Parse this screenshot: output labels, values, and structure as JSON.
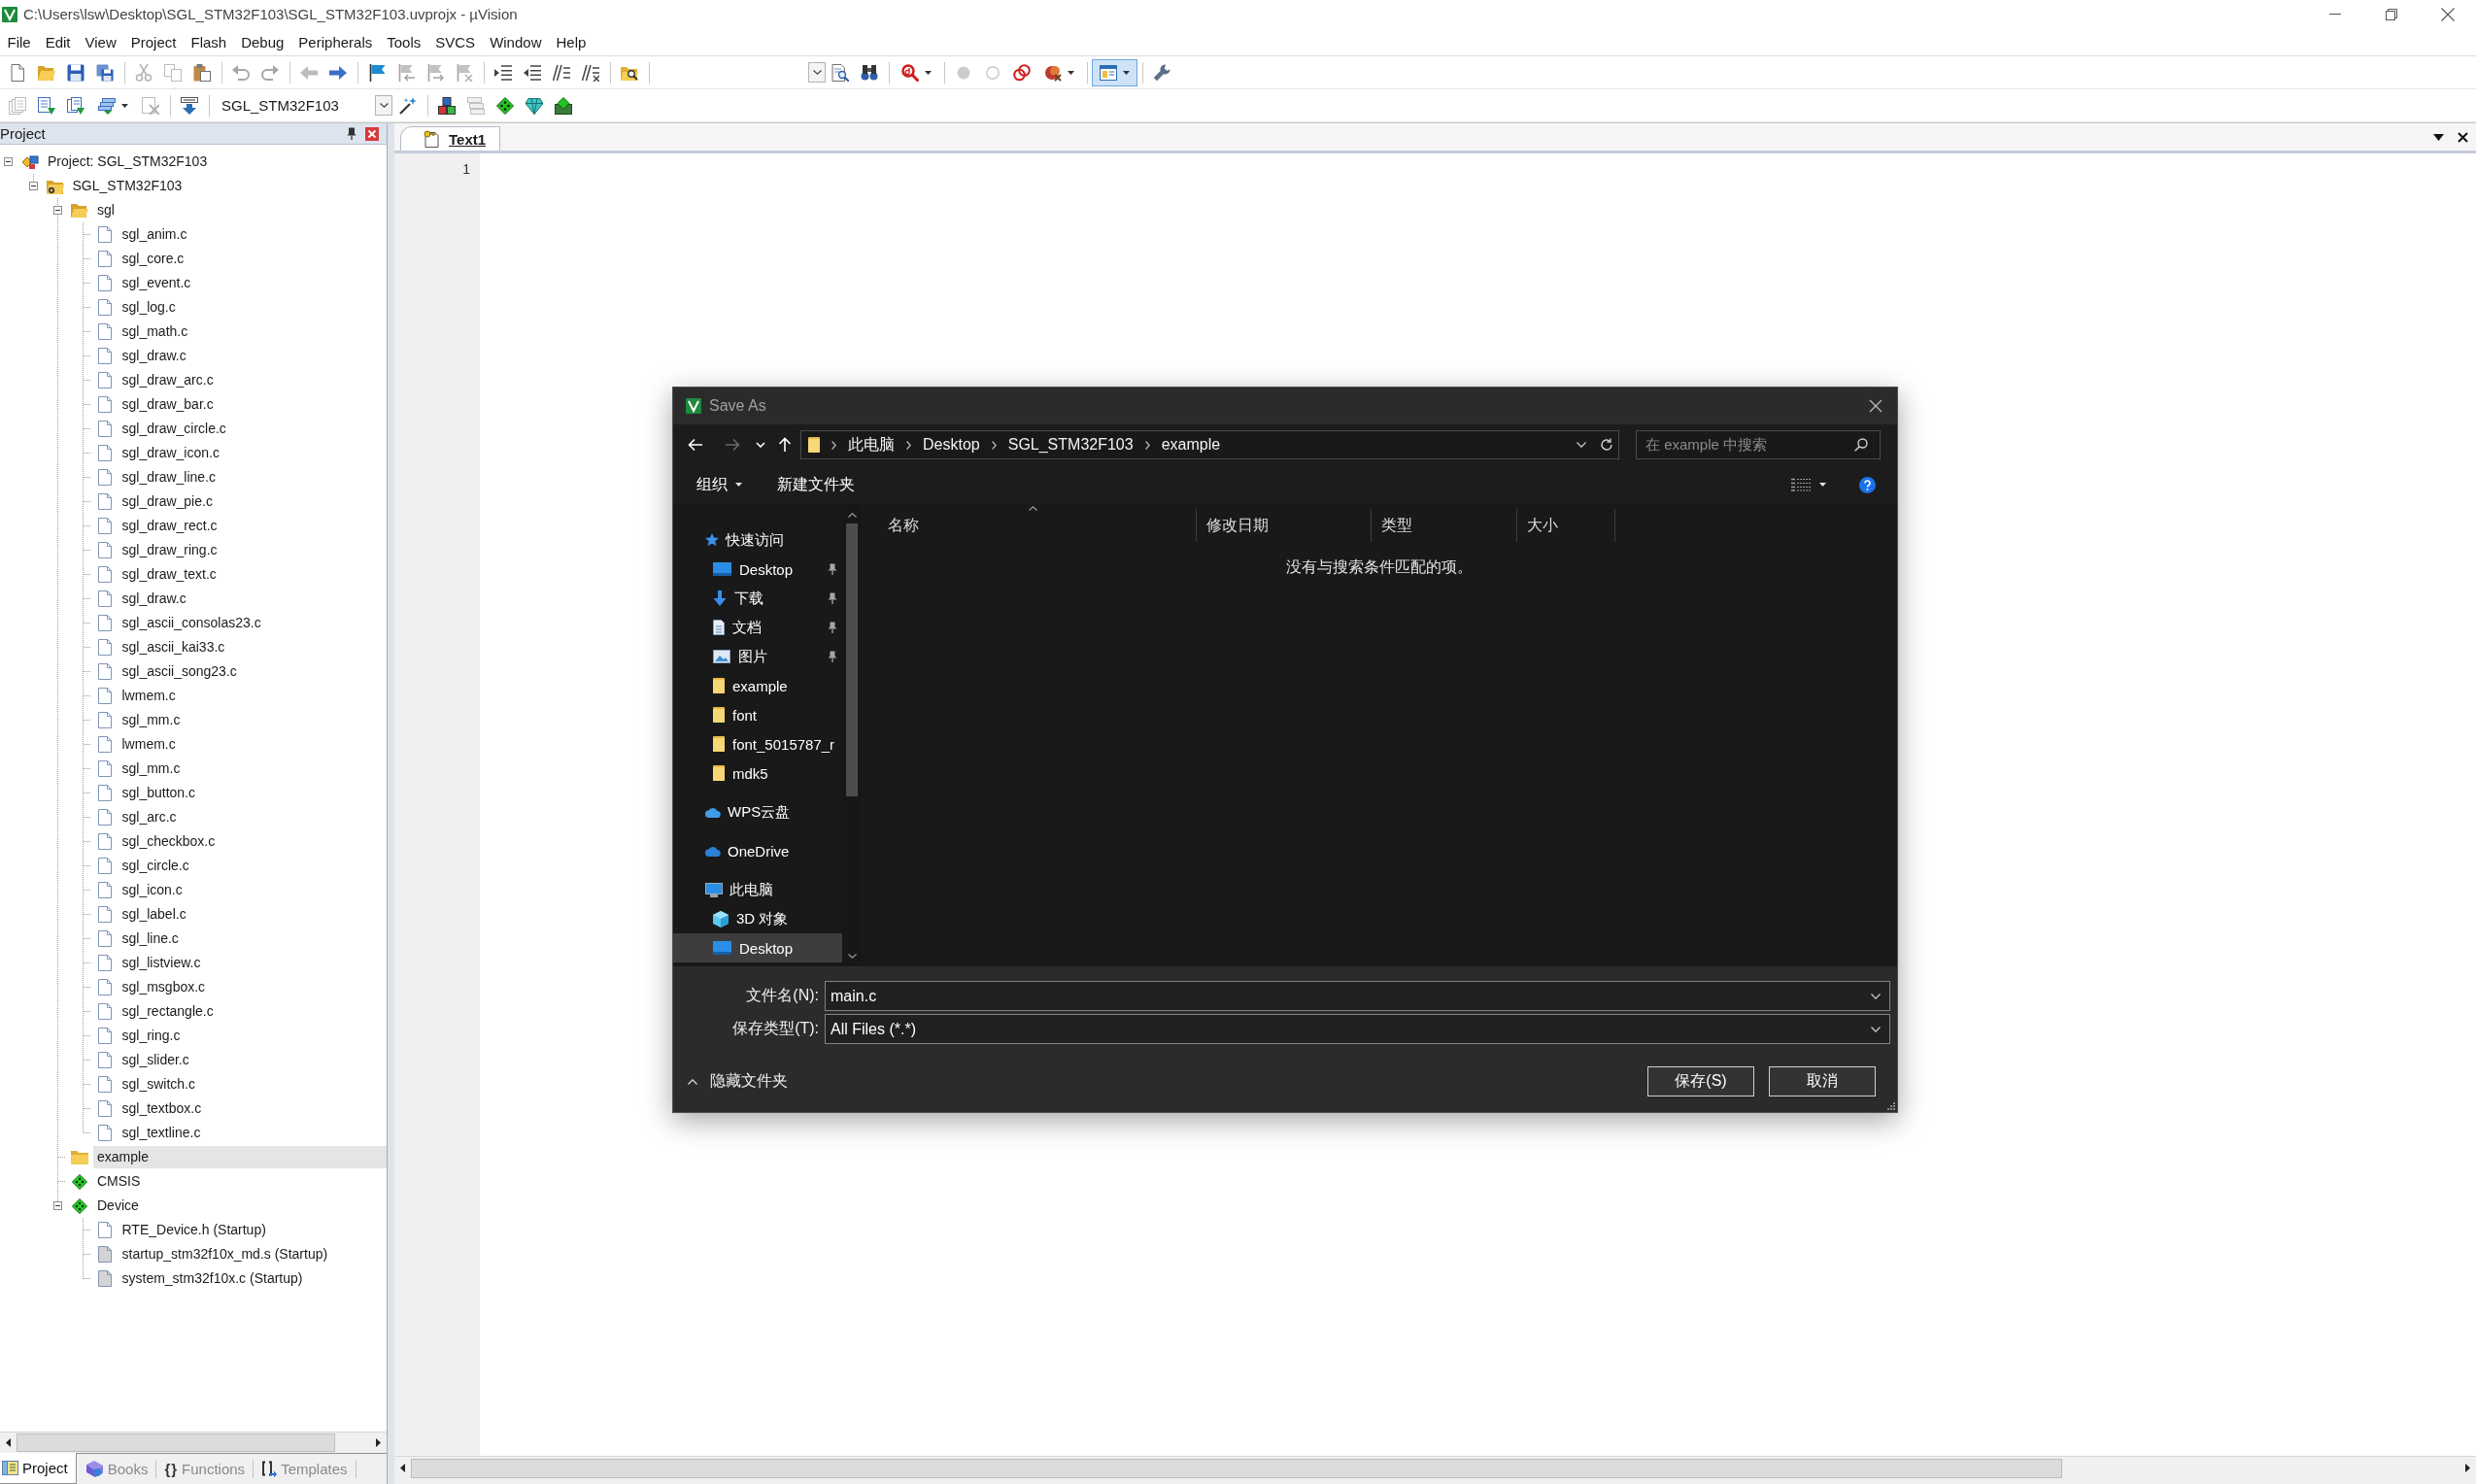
{
  "window": {
    "title": "C:\\Users\\lsw\\Desktop\\SGL_STM32F103\\SGL_STM32F103.uvprojx - µVision"
  },
  "menu": [
    "File",
    "Edit",
    "View",
    "Project",
    "Flash",
    "Debug",
    "Peripherals",
    "Tools",
    "SVCS",
    "Window",
    "Help"
  ],
  "toolbars": [
    {
      "groups": [
        [
          {
            "kind": "new",
            "disabled": false,
            "pressed": false
          },
          {
            "kind": "open",
            "disabled": false,
            "pressed": false
          },
          {
            "kind": "save",
            "disabled": false,
            "pressed": false
          },
          {
            "kind": "save-all",
            "disabled": false,
            "pressed": false
          }
        ],
        [
          {
            "kind": "cut",
            "disabled": true,
            "pressed": false
          },
          {
            "kind": "copy",
            "disabled": true,
            "pressed": false
          },
          {
            "kind": "paste",
            "disabled": false,
            "pressed": false
          }
        ],
        [
          {
            "kind": "undo",
            "disabled": true,
            "pressed": false
          },
          {
            "kind": "redo",
            "disabled": true,
            "pressed": false
          }
        ],
        [
          {
            "kind": "nav-back",
            "disabled": true,
            "pressed": false
          },
          {
            "kind": "nav-forward",
            "disabled": false,
            "pressed": false
          }
        ],
        [
          {
            "kind": "bookmark",
            "disabled": false,
            "pressed": false
          },
          {
            "kind": "prev-bookmark",
            "disabled": true,
            "pressed": false
          },
          {
            "kind": "next-bookmark",
            "disabled": true,
            "pressed": false
          },
          {
            "kind": "clear-bookmarks",
            "disabled": true,
            "pressed": false
          }
        ],
        [
          {
            "kind": "indent",
            "disabled": false,
            "pressed": false
          },
          {
            "kind": "unindent",
            "disabled": false,
            "pressed": false
          },
          {
            "kind": "comment",
            "disabled": false,
            "pressed": false
          },
          {
            "kind": "uncomment",
            "disabled": false,
            "pressed": false
          }
        ],
        [
          {
            "kind": "find-in-files",
            "disabled": false,
            "pressed": false
          }
        ],
        [
          {
            "kind": "find-combo",
            "disabled": false,
            "pressed": false
          },
          {
            "kind": "find",
            "disabled": false,
            "pressed": false
          },
          {
            "kind": "incremental-find",
            "disabled": false,
            "pressed": false
          }
        ],
        [
          {
            "kind": "debug",
            "disabled": false,
            "pressed": false
          }
        ],
        [
          {
            "kind": "breakpoint",
            "disabled": true,
            "pressed": false
          },
          {
            "kind": "enable-breakpoint",
            "disabled": true,
            "pressed": false
          },
          {
            "kind": "disable-breakpoints",
            "disabled": false,
            "pressed": false
          },
          {
            "kind": "kill-breakpoints",
            "disabled": false,
            "pressed": false
          }
        ],
        [
          {
            "kind": "window-layout",
            "disabled": false,
            "pressed": true
          }
        ],
        [
          {
            "kind": "configure",
            "disabled": false,
            "pressed": false
          }
        ]
      ]
    },
    {
      "groups": [
        [
          {
            "kind": "translate",
            "disabled": true,
            "pressed": false
          },
          {
            "kind": "build",
            "disabled": false,
            "pressed": false
          },
          {
            "kind": "rebuild",
            "disabled": false,
            "pressed": false
          },
          {
            "kind": "batch-build",
            "disabled": false,
            "pressed": false
          },
          {
            "kind": "stop-build",
            "disabled": true,
            "pressed": false
          }
        ],
        [
          {
            "kind": "download",
            "disabled": false,
            "pressed": false
          }
        ],
        [
          {
            "kind": "target",
            "disabled": false,
            "pressed": false,
            "value": "SGL_STM32F103"
          },
          {
            "kind": "options",
            "disabled": false,
            "pressed": false
          }
        ],
        [
          {
            "kind": "manage-project",
            "disabled": false,
            "pressed": false
          },
          {
            "kind": "manage-packs",
            "disabled": true,
            "pressed": false
          },
          {
            "kind": "pack-installer",
            "disabled": false,
            "pressed": false
          },
          {
            "kind": "select-packs",
            "disabled": false,
            "pressed": false
          },
          {
            "kind": "manage-rte",
            "disabled": false,
            "pressed": false
          }
        ]
      ]
    }
  ],
  "project_panel": {
    "title": "Project",
    "tree": [
      {
        "label": "Project: SGL_STM32F103",
        "kind": "project",
        "expanded": true,
        "selected": false,
        "children": [
          {
            "label": "SGL_STM32F103",
            "kind": "target",
            "expanded": true,
            "selected": false,
            "children": [
              {
                "label": "sgl",
                "kind": "group",
                "expanded": true,
                "selected": false,
                "children": [
                  {
                    "label": "sgl_anim.c",
                    "kind": "file",
                    "selected": false
                  },
                  {
                    "label": "sgl_core.c",
                    "kind": "file",
                    "selected": false
                  },
                  {
                    "label": "sgl_event.c",
                    "kind": "file",
                    "selected": false
                  },
                  {
                    "label": "sgl_log.c",
                    "kind": "file",
                    "selected": false
                  },
                  {
                    "label": "sgl_math.c",
                    "kind": "file",
                    "selected": false
                  },
                  {
                    "label": "sgl_draw.c",
                    "kind": "file",
                    "selected": false
                  },
                  {
                    "label": "sgl_draw_arc.c",
                    "kind": "file",
                    "selected": false
                  },
                  {
                    "label": "sgl_draw_bar.c",
                    "kind": "file",
                    "selected": false
                  },
                  {
                    "label": "sgl_draw_circle.c",
                    "kind": "file",
                    "selected": false
                  },
                  {
                    "label": "sgl_draw_icon.c",
                    "kind": "file",
                    "selected": false
                  },
                  {
                    "label": "sgl_draw_line.c",
                    "kind": "file",
                    "selected": false
                  },
                  {
                    "label": "sgl_draw_pie.c",
                    "kind": "file",
                    "selected": false
                  },
                  {
                    "label": "sgl_draw_rect.c",
                    "kind": "file",
                    "selected": false
                  },
                  {
                    "label": "sgl_draw_ring.c",
                    "kind": "file",
                    "selected": false
                  },
                  {
                    "label": "sgl_draw_text.c",
                    "kind": "file",
                    "selected": false
                  },
                  {
                    "label": "sgl_draw.c",
                    "kind": "file",
                    "selected": false
                  },
                  {
                    "label": "sgl_ascii_consolas23.c",
                    "kind": "file",
                    "selected": false
                  },
                  {
                    "label": "sgl_ascii_kai33.c",
                    "kind": "file",
                    "selected": false
                  },
                  {
                    "label": "sgl_ascii_song23.c",
                    "kind": "file",
                    "selected": false
                  },
                  {
                    "label": "lwmem.c",
                    "kind": "file",
                    "selected": false
                  },
                  {
                    "label": "sgl_mm.c",
                    "kind": "file",
                    "selected": false
                  },
                  {
                    "label": "lwmem.c",
                    "kind": "file",
                    "selected": false
                  },
                  {
                    "label": "sgl_mm.c",
                    "kind": "file",
                    "selected": false
                  },
                  {
                    "label": "sgl_button.c",
                    "kind": "file",
                    "selected": false
                  },
                  {
                    "label": "sgl_arc.c",
                    "kind": "file",
                    "selected": false
                  },
                  {
                    "label": "sgl_checkbox.c",
                    "kind": "file",
                    "selected": false
                  },
                  {
                    "label": "sgl_circle.c",
                    "kind": "file",
                    "selected": false
                  },
                  {
                    "label": "sgl_icon.c",
                    "kind": "file",
                    "selected": false
                  },
                  {
                    "label": "sgl_label.c",
                    "kind": "file",
                    "selected": false
                  },
                  {
                    "label": "sgl_line.c",
                    "kind": "file",
                    "selected": false
                  },
                  {
                    "label": "sgl_listview.c",
                    "kind": "file",
                    "selected": false
                  },
                  {
                    "label": "sgl_msgbox.c",
                    "kind": "file",
                    "selected": false
                  },
                  {
                    "label": "sgl_rectangle.c",
                    "kind": "file",
                    "selected": false
                  },
                  {
                    "label": "sgl_ring.c",
                    "kind": "file",
                    "selected": false
                  },
                  {
                    "label": "sgl_slider.c",
                    "kind": "file",
                    "selected": false
                  },
                  {
                    "label": "sgl_switch.c",
                    "kind": "file",
                    "selected": false
                  },
                  {
                    "label": "sgl_textbox.c",
                    "kind": "file",
                    "selected": false
                  },
                  {
                    "label": "sgl_textline.c",
                    "kind": "file",
                    "selected": false
                  }
                ]
              },
              {
                "label": "example",
                "kind": "group",
                "selected": true
              },
              {
                "label": "CMSIS",
                "kind": "component",
                "selected": false
              },
              {
                "label": "Device",
                "kind": "component",
                "expanded": true,
                "selected": false,
                "children": [
                  {
                    "label": "RTE_Device.h (Startup)",
                    "kind": "file",
                    "selected": false
                  },
                  {
                    "label": "startup_stm32f10x_md.s (Startup)",
                    "kind": "readonly-file",
                    "selected": false
                  },
                  {
                    "label": "system_stm32f10x.c (Startup)",
                    "kind": "readonly-file",
                    "selected": false
                  }
                ]
              }
            ]
          }
        ]
      }
    ],
    "tabs": [
      {
        "label": "Project",
        "kind": "project",
        "selected": true
      },
      {
        "label": "Books",
        "kind": "books",
        "selected": false
      },
      {
        "label": "Functions",
        "kind": "functions",
        "glyph": "{}",
        "selected": false
      },
      {
        "label": "Templates",
        "kind": "templates",
        "selected": false
      }
    ]
  },
  "editor": {
    "tabs": [
      {
        "label": "Text1",
        "selected": true
      }
    ],
    "line_numbers": [
      "1"
    ]
  },
  "save_dialog": {
    "title": "Save As",
    "history": [
      {
        "kind": "back",
        "disabled": false
      },
      {
        "kind": "forward",
        "disabled": true
      },
      {
        "kind": "recent",
        "disabled": false
      },
      {
        "kind": "up",
        "disabled": false
      }
    ],
    "address": [
      "此电脑",
      "Desktop",
      "SGL_STM32F103",
      "example"
    ],
    "search": {
      "placeholder": "在 example 中搜索"
    },
    "commands": [
      {
        "label": "组织",
        "kind": "menu"
      },
      {
        "label": "新建文件夹",
        "kind": "button"
      }
    ],
    "navigation": [
      {
        "label": "快速访问",
        "kind": "quick-access",
        "selected": false,
        "children": [
          {
            "label": "Desktop",
            "kind": "desktop",
            "pinned": true,
            "selected": false
          },
          {
            "label": "下载",
            "kind": "downloads",
            "pinned": true,
            "selected": false
          },
          {
            "label": "文档",
            "kind": "documents",
            "pinned": true,
            "selected": false
          },
          {
            "label": "图片",
            "kind": "pictures",
            "pinned": true,
            "selected": false
          },
          {
            "label": "example",
            "kind": "folder",
            "pinned": false,
            "selected": false
          },
          {
            "label": "font",
            "kind": "folder",
            "pinned": false,
            "selected": false
          },
          {
            "label": "font_5015787_r",
            "kind": "folder",
            "pinned": false,
            "selected": false
          },
          {
            "label": "mdk5",
            "kind": "folder",
            "pinned": false,
            "selected": false
          }
        ]
      },
      {
        "label": "WPS云盘",
        "kind": "cloud",
        "selected": false
      },
      {
        "label": "OneDrive",
        "kind": "onedrive",
        "selected": false
      },
      {
        "label": "此电脑",
        "kind": "computer",
        "selected": false,
        "children": [
          {
            "label": "3D 对象",
            "kind": "objects3d",
            "pinned": false,
            "selected": false
          },
          {
            "label": "Desktop",
            "kind": "desktop",
            "pinned": false,
            "selected": true
          }
        ]
      }
    ],
    "columns": [
      {
        "label": "名称",
        "sorted": true
      },
      {
        "label": "修改日期",
        "sorted": false
      },
      {
        "label": "类型",
        "sorted": false
      },
      {
        "label": "大小",
        "sorted": false
      }
    ],
    "empty_message": "没有与搜索条件匹配的项。",
    "fields": [
      {
        "label": "文件名(N):",
        "value": "main.c"
      },
      {
        "label": "保存类型(T):",
        "value": "All Files (*.*)"
      }
    ],
    "folders_toggle": {
      "label": "隐藏文件夹",
      "expanded": true
    },
    "buttons": [
      "保存(S)",
      "取消"
    ]
  }
}
